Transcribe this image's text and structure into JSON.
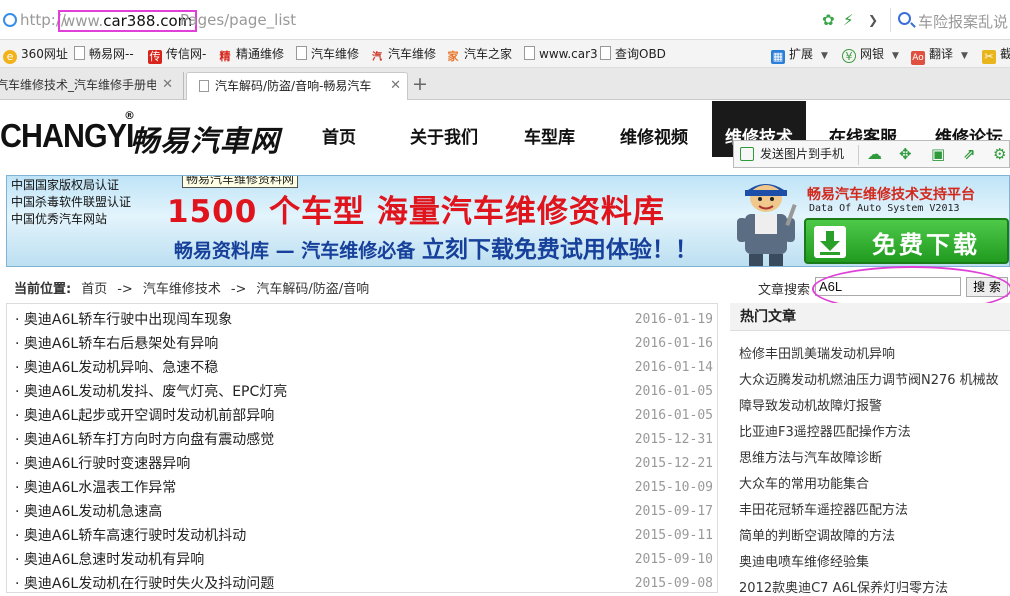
{
  "browser": {
    "url_protocol": "http://",
    "url_host_prefix": "www.",
    "url_host": "car388.com",
    "url_path": "Pages/page_list",
    "search_placeholder": "车险报案乱说",
    "highlight_color": "#e040d8"
  },
  "bookmarks": [
    {
      "label": "360网址",
      "icon": "360-icon"
    },
    {
      "label": "畅易网--",
      "icon": "page-icon"
    },
    {
      "label": "传信网-",
      "icon": "chuan-icon"
    },
    {
      "label": "精通维修",
      "icon": "jing-icon"
    },
    {
      "label": "汽车维修",
      "icon": "page-icon"
    },
    {
      "label": "汽车维修",
      "icon": "car-repair-icon"
    },
    {
      "label": "汽车之家",
      "icon": "autohome-icon"
    },
    {
      "label": "www.car3",
      "icon": "page-icon"
    },
    {
      "label": "查询OBD",
      "icon": "page-icon"
    },
    {
      "label": "扩展",
      "icon": "grid-icon"
    },
    {
      "label": "网银",
      "icon": "bank-icon"
    },
    {
      "label": "翻译",
      "icon": "translate-icon"
    },
    {
      "label": "截",
      "icon": "screenshot-icon"
    }
  ],
  "tabs": [
    {
      "label": "汽车维修技术_汽车维修手册电",
      "active": false
    },
    {
      "label": "汽车解码/防盗/音响-畅易汽车",
      "active": true
    }
  ],
  "site": {
    "logo_en": "CHANGYI",
    "logo_reg": "®",
    "logo_cn": "畅易汽車网",
    "nav": [
      "首页",
      "关于我们",
      "车型库",
      "维修视频",
      "维修技术",
      "在线客服",
      "维修论坛"
    ],
    "nav_active_index": 4
  },
  "screenshot_bar": {
    "send_label": "发送图片到手机"
  },
  "banner": {
    "certs": [
      "中国国家版权局认证",
      "中国杀毒软件联盟认证",
      "中国优秀汽车网站"
    ],
    "tooltip": "畅易汽车维修资料网",
    "headline1": "1500 个车型    海量汽车维修资料库",
    "headline2_a": "畅易资料库 — 汽车维修必备 ",
    "headline2_b": "立刻下载免费试用体验！！",
    "platform": "畅易汽车维修技术支持平台",
    "platform_en": "Data Of Auto System V2013",
    "download": "免费下载"
  },
  "breadcrumb": {
    "lead": "当前位置:",
    "items": [
      "首页",
      "汽车维修技术",
      "汽车解码/防盗/音响"
    ],
    "separator": "->"
  },
  "search": {
    "label": "文章搜索",
    "value": "A6L",
    "button": "搜 索"
  },
  "articles": [
    {
      "title": "奥迪A6L轿车行驶中出现闯车现象",
      "date": "2016-01-19"
    },
    {
      "title": "奥迪A6L轿车右后悬架处有异响",
      "date": "2016-01-16"
    },
    {
      "title": "奥迪A6L发动机异响、急速不稳",
      "date": "2016-01-14"
    },
    {
      "title": "奥迪A6L发动机发抖、废气灯亮、EPC灯亮",
      "date": "2016-01-05"
    },
    {
      "title": "奥迪A6L起步或开空调时发动机前部异响",
      "date": "2016-01-05"
    },
    {
      "title": "奥迪A6L轿车打方向时方向盘有震动感觉",
      "date": "2015-12-31"
    },
    {
      "title": "奥迪A6L行驶时变速器异响",
      "date": "2015-12-21"
    },
    {
      "title": "奥迪A6L水温表工作异常",
      "date": "2015-10-09"
    },
    {
      "title": "奥迪A6L发动机急速高",
      "date": "2015-09-17"
    },
    {
      "title": "奥迪A6L轿车高速行驶时发动机抖动",
      "date": "2015-09-11"
    },
    {
      "title": "奥迪A6L怠速时发动机有异响",
      "date": "2015-09-10"
    },
    {
      "title": "奥迪A6L发动机在行驶时失火及抖动问题",
      "date": "2015-09-08"
    }
  ],
  "hot": {
    "title": "热门文章",
    "items": [
      "检修丰田凯美瑞发动机异响",
      "大众迈腾发动机燃油压力调节阀N276 机械故",
      "障导致发动机故障灯报警",
      "比亚迪F3遥控器匹配操作方法",
      "思维方法与汽车故障诊断",
      "大众车的常用功能集合",
      "丰田花冠轿车遥控器匹配方法",
      "简单的判断空调故障的方法",
      "奥迪电喷车维修经验集",
      "2012款奥迪C7 A6L保养灯归零方法"
    ]
  }
}
